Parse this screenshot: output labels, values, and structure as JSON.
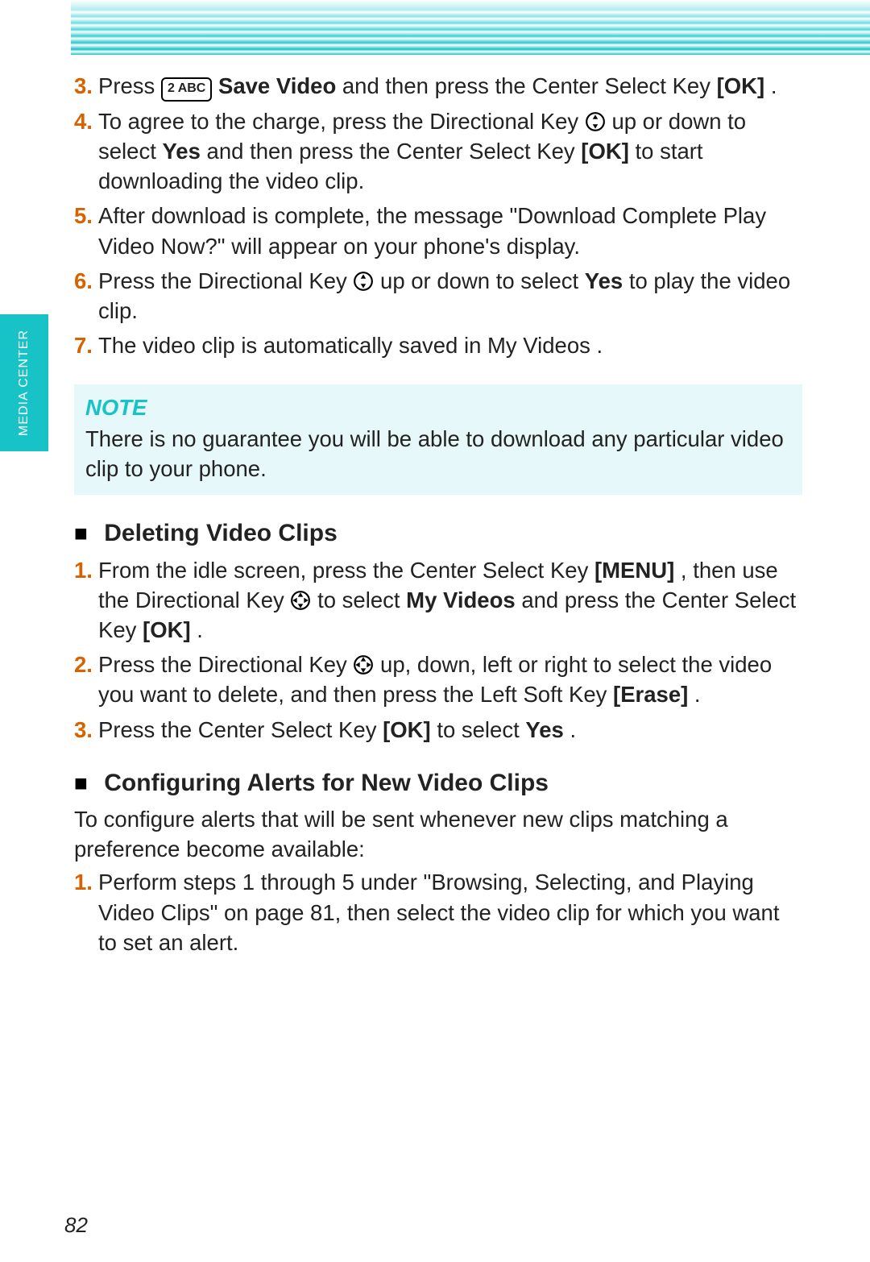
{
  "side_tab": "MEDIA CENTER",
  "page_number": "82",
  "icons": {
    "key2": "2 ABC",
    "dir_ud": "up-down",
    "dir_all": "all"
  },
  "section_a": {
    "s3_lead": "Press ",
    "s3_bold1": "Save Video",
    "s3_mid": " and then press the Center Select Key ",
    "s3_bold2": "[OK]",
    "s3_end": ".",
    "s4_lead": "To agree to the charge, press the Directional Key ",
    "s4_mid": " up or down to select ",
    "s4_yes": "Yes",
    "s4_mid2": " and then press the Center Select Key ",
    "s4_ok": "[OK]",
    "s4_end": " to start downloading the video clip.",
    "s5": "After download is complete, the message \"Download Complete Play Video Now?\" will appear on your phone's display.",
    "s6_lead": "Press the Directional Key ",
    "s6_mid": " up or down to select ",
    "s6_yes": "Yes",
    "s6_end": " to play the video clip.",
    "s7": "The video clip is automatically saved in My Videos ."
  },
  "note": {
    "title": "NOTE",
    "text": "There is no guarantee you will be able to download any particular video clip to your phone."
  },
  "section_b": {
    "title": "Deleting Video Clips",
    "s1_lead": "From the idle screen, press the Center Select Key ",
    "s1_menu": "[MENU]",
    "s1_mid": ", then use the Directional Key ",
    "s1_mid2": " to select ",
    "s1_myvid": "My Videos",
    "s1_mid3": " and press the Center Select Key ",
    "s1_ok": "[OK]",
    "s1_end": ".",
    "s2_lead": "Press the Directional Key ",
    "s2_mid": " up, down, left or right to select the video you want to delete, and then press the Left Soft Key ",
    "s2_erase": "[Erase]",
    "s2_end": ".",
    "s3_lead": "Press the Center Select Key ",
    "s3_ok": "[OK]",
    "s3_mid": " to select ",
    "s3_yes": "Yes",
    "s3_end": "."
  },
  "section_c": {
    "title": "Configuring Alerts for New Video Clips",
    "intro": "To configure alerts that will be sent whenever new clips matching a preference become available:",
    "s1": "Perform steps 1 through 5 under \"Browsing, Selecting, and Playing Video Clips\" on page 81, then select the video clip for which you want to set an alert."
  }
}
